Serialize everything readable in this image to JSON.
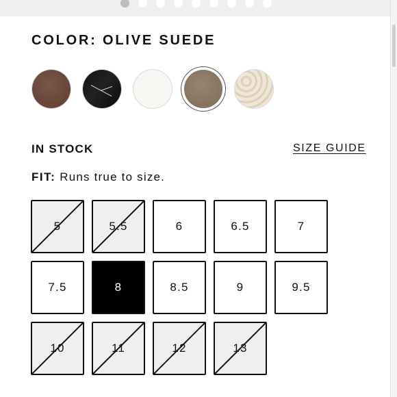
{
  "carousel": {
    "dot_count": 9,
    "active_index": 0
  },
  "color": {
    "heading": "COLOR: OLIVE SUEDE",
    "selected_index": 3,
    "swatches": [
      {
        "name": "swatch-brown",
        "color": "#6b4a3c"
      },
      {
        "name": "swatch-black-marble",
        "color": "#111111"
      },
      {
        "name": "swatch-white",
        "color": "#f7f6f3"
      },
      {
        "name": "swatch-olive-suede",
        "color": "#8a7765"
      },
      {
        "name": "swatch-cream-knit",
        "color": "#e8dccb"
      }
    ]
  },
  "stock": {
    "label": "IN STOCK"
  },
  "size_guide": {
    "label": "SIZE GUIDE"
  },
  "fit": {
    "label": "FIT:",
    "text": "Runs true to size."
  },
  "sizes": [
    {
      "label": "5",
      "available": false,
      "selected": false
    },
    {
      "label": "5.5",
      "available": false,
      "selected": false
    },
    {
      "label": "6",
      "available": true,
      "selected": false
    },
    {
      "label": "6.5",
      "available": true,
      "selected": false
    },
    {
      "label": "7",
      "available": true,
      "selected": false
    },
    {
      "label": "7.5",
      "available": true,
      "selected": false
    },
    {
      "label": "8",
      "available": true,
      "selected": true
    },
    {
      "label": "8.5",
      "available": true,
      "selected": false
    },
    {
      "label": "9",
      "available": true,
      "selected": false
    },
    {
      "label": "9.5",
      "available": true,
      "selected": false
    },
    {
      "label": "10",
      "available": false,
      "selected": false
    },
    {
      "label": "11",
      "available": false,
      "selected": false
    },
    {
      "label": "12",
      "available": false,
      "selected": false
    },
    {
      "label": "13",
      "available": false,
      "selected": false
    }
  ]
}
